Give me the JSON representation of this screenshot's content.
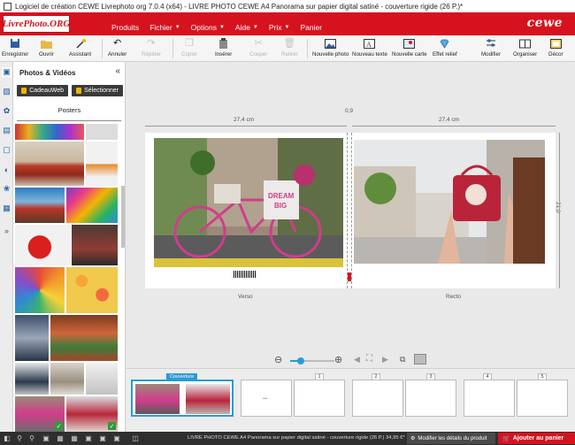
{
  "window": {
    "title": "Logiciel de création CEWE Livrephoto org 7.0.4 (x64) - LIVRE PHOTO CEWE A4 Panorama sur papier digital satiné - couverture rigide (26 P.)*"
  },
  "header": {
    "logo_text": "LivrePhoto.ORG",
    "brand": "cewe",
    "menu": [
      {
        "label": "Produits",
        "caret": false
      },
      {
        "label": "Fichier",
        "caret": true
      },
      {
        "label": "Options",
        "caret": true
      },
      {
        "label": "Aide",
        "caret": true
      },
      {
        "label": "Prix",
        "caret": true
      },
      {
        "label": "Panier",
        "caret": false
      }
    ]
  },
  "toolbar": {
    "save": "Enregistrer",
    "open": "Ouvrir",
    "assistant": "Assistant",
    "undo": "Annuler",
    "redo": "Répéter",
    "copy": "Copier",
    "insert": "Insérer",
    "cut": "Couper",
    "remove": "Retirer",
    "new_photo": "Nouvelle photo",
    "new_text": "Nouveau texte",
    "new_map": "Nouvelle carte",
    "relief": "Effet relief",
    "edit": "Modifier",
    "organize": "Organiser",
    "decor": "Décor"
  },
  "panel": {
    "title": "Photos & Vidéos",
    "close": "«",
    "cadeauweb": "CadeauWeb",
    "select": "Sélectionner",
    "category": "Posters"
  },
  "canvas": {
    "width_left": "27,4 cm",
    "spine": "0,9",
    "width_right": "27,4 cm",
    "height": "21,0 cm",
    "verso": "Verso",
    "recto": "Recto",
    "photo_left_text1": "DREAM",
    "photo_left_text2": "BIG"
  },
  "filmstrip": {
    "cover_label": "Couverture",
    "page_numbers": [
      "1",
      "2",
      "3",
      "4",
      "5"
    ]
  },
  "bottom": {
    "product_text": "LIVRE PHOTO CEWE A4 Panorama sur papier digital satiné - couverture rigide (26 P.) 34,95 €*",
    "details": "Modifier les détails du produit",
    "cart": "Ajouter au panier"
  },
  "colors": {
    "brand_red": "#d7121f",
    "accent_blue": "#2a9bd6",
    "check_green": "#2e9b3a"
  }
}
